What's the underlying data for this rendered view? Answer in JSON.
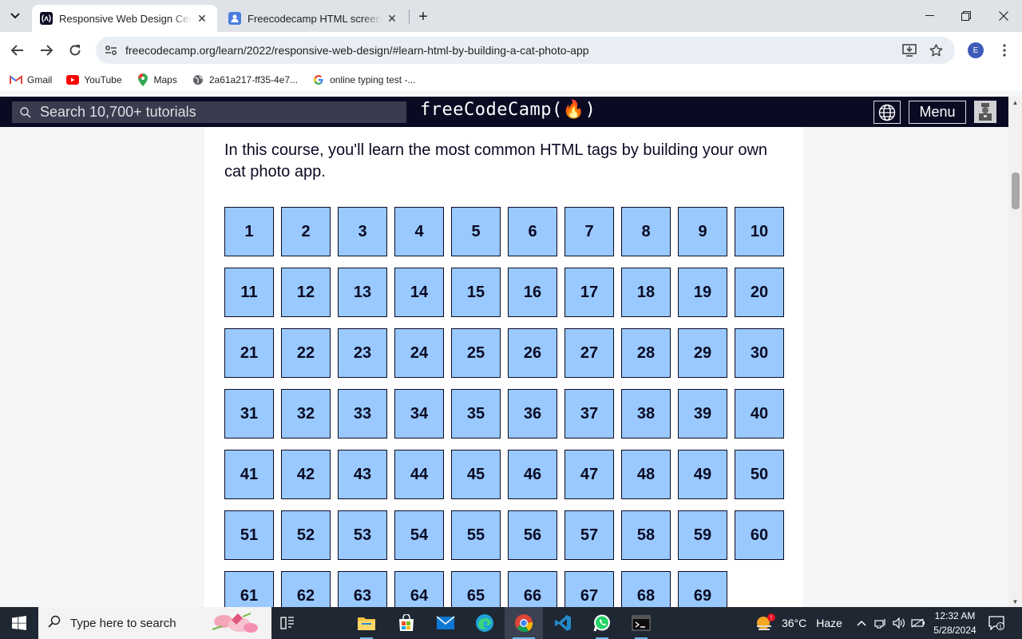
{
  "browser": {
    "tabs": [
      {
        "title": "Responsive Web Design Certific",
        "active": true
      },
      {
        "title": "Freecodecamp HTML screen sh",
        "active": false
      }
    ],
    "url": "freecodecamp.org/learn/2022/responsive-web-design/#learn-html-by-building-a-cat-photo-app",
    "profile_initial": "E",
    "bookmarks": [
      {
        "label": "Gmail",
        "icon": "gmail-icon"
      },
      {
        "label": "YouTube",
        "icon": "youtube-icon"
      },
      {
        "label": "Maps",
        "icon": "maps-icon"
      },
      {
        "label": "2a61a217-ff35-4e7...",
        "icon": "globe-icon"
      },
      {
        "label": "online typing test -...",
        "icon": "google-icon"
      }
    ]
  },
  "site": {
    "search_placeholder": "Search 10,700+ tutorials",
    "logo": "freeCodeCamp(🔥)",
    "menu_label": "Menu"
  },
  "course": {
    "intro": "In this course, you'll learn the most common HTML tags by building your own cat photo app.",
    "steps": [
      1,
      2,
      3,
      4,
      5,
      6,
      7,
      8,
      9,
      10,
      11,
      12,
      13,
      14,
      15,
      16,
      17,
      18,
      19,
      20,
      21,
      22,
      23,
      24,
      25,
      26,
      27,
      28,
      29,
      30,
      31,
      32,
      33,
      34,
      35,
      36,
      37,
      38,
      39,
      40,
      41,
      42,
      43,
      44,
      45,
      46,
      47,
      48,
      49,
      50,
      51,
      52,
      53,
      54,
      55,
      56,
      57,
      58,
      59,
      60,
      61,
      62,
      63,
      64,
      65,
      66,
      67,
      68,
      69
    ]
  },
  "taskbar": {
    "search_placeholder": "Type here to search",
    "weather": {
      "temp": "36°C",
      "condition": "Haze"
    },
    "time": "12:32 AM",
    "date": "5/28/2024",
    "notification_count": "1"
  },
  "colors": {
    "step_bg": "#99c9ff",
    "nav_bg": "#0a0a23",
    "taskbar_bg": "#1f2733"
  }
}
